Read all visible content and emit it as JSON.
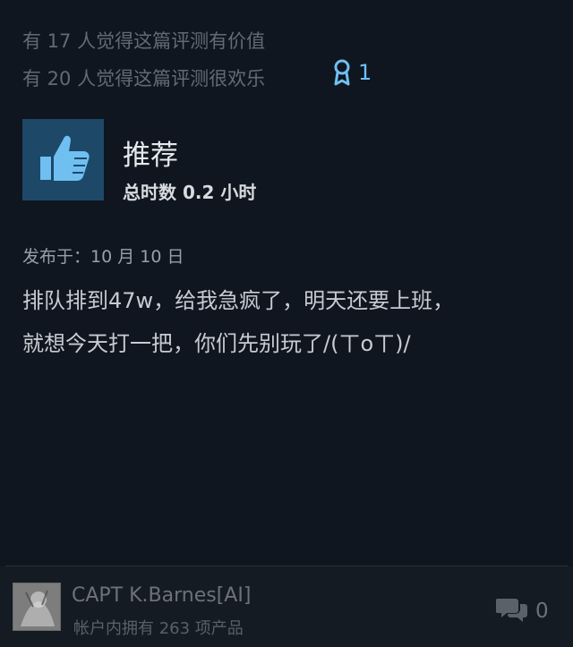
{
  "helpful": {
    "line1": "有 17 人觉得这篇评测有价值",
    "line2": "有 20 人觉得这篇评测很欢乐"
  },
  "award": {
    "icon": "award-ribbon-icon",
    "count": "1",
    "color": "#6fc0f0"
  },
  "review": {
    "verdict": "推荐",
    "verdict_icon": "thumbs-up-icon",
    "hours": "总时数 0.2 小时",
    "posted": "发布于：10 月 10 日",
    "text_line1": "排队排到47w，给我急疯了，明天还要上班，",
    "text_line2": "就想今天打一把，你们先别玩了/(ㄒoㄒ)/"
  },
  "author": {
    "name": "CAPT K.Barnes[AI]",
    "products": "帐户内拥有 263 项产品"
  },
  "comments": {
    "icon": "comment-bubbles-icon",
    "count": "0"
  },
  "colors": {
    "background": "#0f1620",
    "thumb_box": "#1e4868",
    "thumb": "#6fc0f0"
  }
}
